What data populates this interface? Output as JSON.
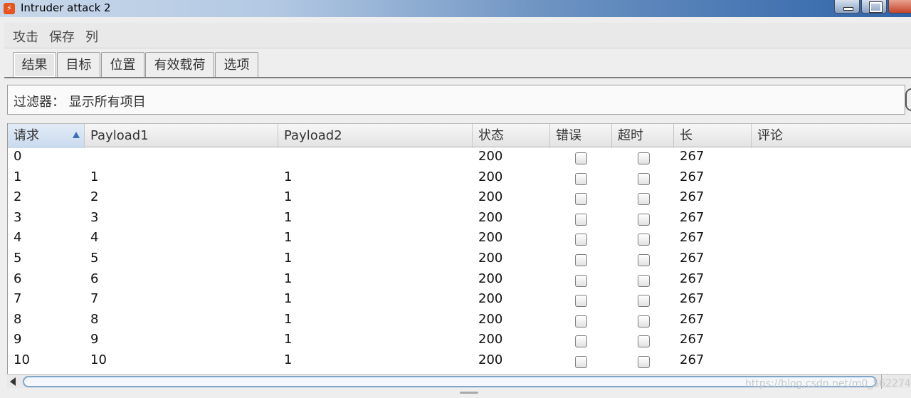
{
  "window": {
    "title": "Intruder attack 2"
  },
  "menu": {
    "items": [
      "攻击",
      "保存",
      "列"
    ]
  },
  "tabs": [
    {
      "label": "结果",
      "active": true
    },
    {
      "label": "目标",
      "active": false
    },
    {
      "label": "位置",
      "active": false
    },
    {
      "label": "有效载荷",
      "active": false
    },
    {
      "label": "选项",
      "active": false
    }
  ],
  "filter": {
    "label": "过滤器：  显示所有项目"
  },
  "table": {
    "columns": [
      "请求",
      "Payload1",
      "Payload2",
      "状态",
      "错误",
      "超时",
      "长",
      "评论"
    ],
    "sorted_column": "请求",
    "rows": [
      {
        "request": "0",
        "payload1": "",
        "payload2": "",
        "status": "200",
        "error": false,
        "timeout": false,
        "length": "267",
        "comment": ""
      },
      {
        "request": "1",
        "payload1": "1",
        "payload2": "1",
        "status": "200",
        "error": false,
        "timeout": false,
        "length": "267",
        "comment": ""
      },
      {
        "request": "2",
        "payload1": "2",
        "payload2": "1",
        "status": "200",
        "error": false,
        "timeout": false,
        "length": "267",
        "comment": ""
      },
      {
        "request": "3",
        "payload1": "3",
        "payload2": "1",
        "status": "200",
        "error": false,
        "timeout": false,
        "length": "267",
        "comment": ""
      },
      {
        "request": "4",
        "payload1": "4",
        "payload2": "1",
        "status": "200",
        "error": false,
        "timeout": false,
        "length": "267",
        "comment": ""
      },
      {
        "request": "5",
        "payload1": "5",
        "payload2": "1",
        "status": "200",
        "error": false,
        "timeout": false,
        "length": "267",
        "comment": ""
      },
      {
        "request": "6",
        "payload1": "6",
        "payload2": "1",
        "status": "200",
        "error": false,
        "timeout": false,
        "length": "267",
        "comment": ""
      },
      {
        "request": "7",
        "payload1": "7",
        "payload2": "1",
        "status": "200",
        "error": false,
        "timeout": false,
        "length": "267",
        "comment": ""
      },
      {
        "request": "8",
        "payload1": "8",
        "payload2": "1",
        "status": "200",
        "error": false,
        "timeout": false,
        "length": "267",
        "comment": ""
      },
      {
        "request": "9",
        "payload1": "9",
        "payload2": "1",
        "status": "200",
        "error": false,
        "timeout": false,
        "length": "267",
        "comment": ""
      },
      {
        "request": "10",
        "payload1": "10",
        "payload2": "1",
        "status": "200",
        "error": false,
        "timeout": false,
        "length": "267",
        "comment": ""
      }
    ]
  },
  "watermark": "https://blog.csdn.net/m0_5622741",
  "icons": {
    "app": "burp-logo-icon",
    "sort": "sort-ascending-icon",
    "scroll_left": "arrow-left-icon"
  }
}
